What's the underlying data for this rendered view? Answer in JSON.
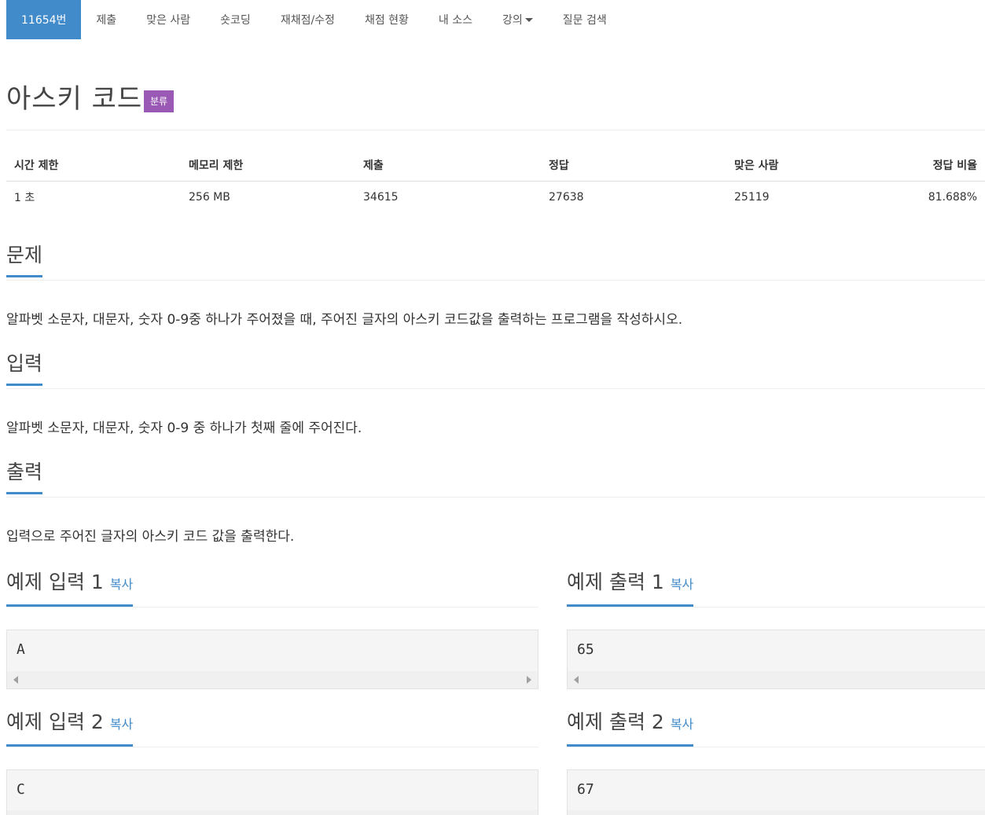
{
  "nav": {
    "problem_id": "11654번",
    "submit": "제출",
    "solved": "맞은 사람",
    "shortcoding": "숏코딩",
    "rejudge": "재채점/수정",
    "status": "채점 현황",
    "my_source": "내 소스",
    "lecture": "강의",
    "question_search": "질문 검색"
  },
  "problem": {
    "title": "아스키 코드",
    "badge": "분류"
  },
  "info": {
    "headers": [
      "시간 제한",
      "메모리 제한",
      "제출",
      "정답",
      "맞은 사람",
      "정답 비율"
    ],
    "values": [
      "1 초",
      "256 MB",
      "34615",
      "27638",
      "25119",
      "81.688%"
    ]
  },
  "sections": {
    "description_title": "문제",
    "description_text": "알파벳 소문자, 대문자, 숫자 0-9중 하나가 주어졌을 때, 주어진 글자의 아스키 코드값을 출력하는 프로그램을 작성하시오.",
    "input_title": "입력",
    "input_text": "알파벳 소문자, 대문자, 숫자 0-9 중 하나가 첫째 줄에 주어진다.",
    "output_title": "출력",
    "output_text": "입력으로 주어진 글자의 아스키 코드 값을 출력한다."
  },
  "samples": {
    "copy_label": "복사",
    "input1_title": "예제 입력 1",
    "input1_value": "A",
    "output1_title": "예제 출력 1",
    "output1_value": "65",
    "input2_title": "예제 입력 2",
    "input2_value": "C",
    "output2_title": "예제 출력 2",
    "output2_value": "67"
  }
}
